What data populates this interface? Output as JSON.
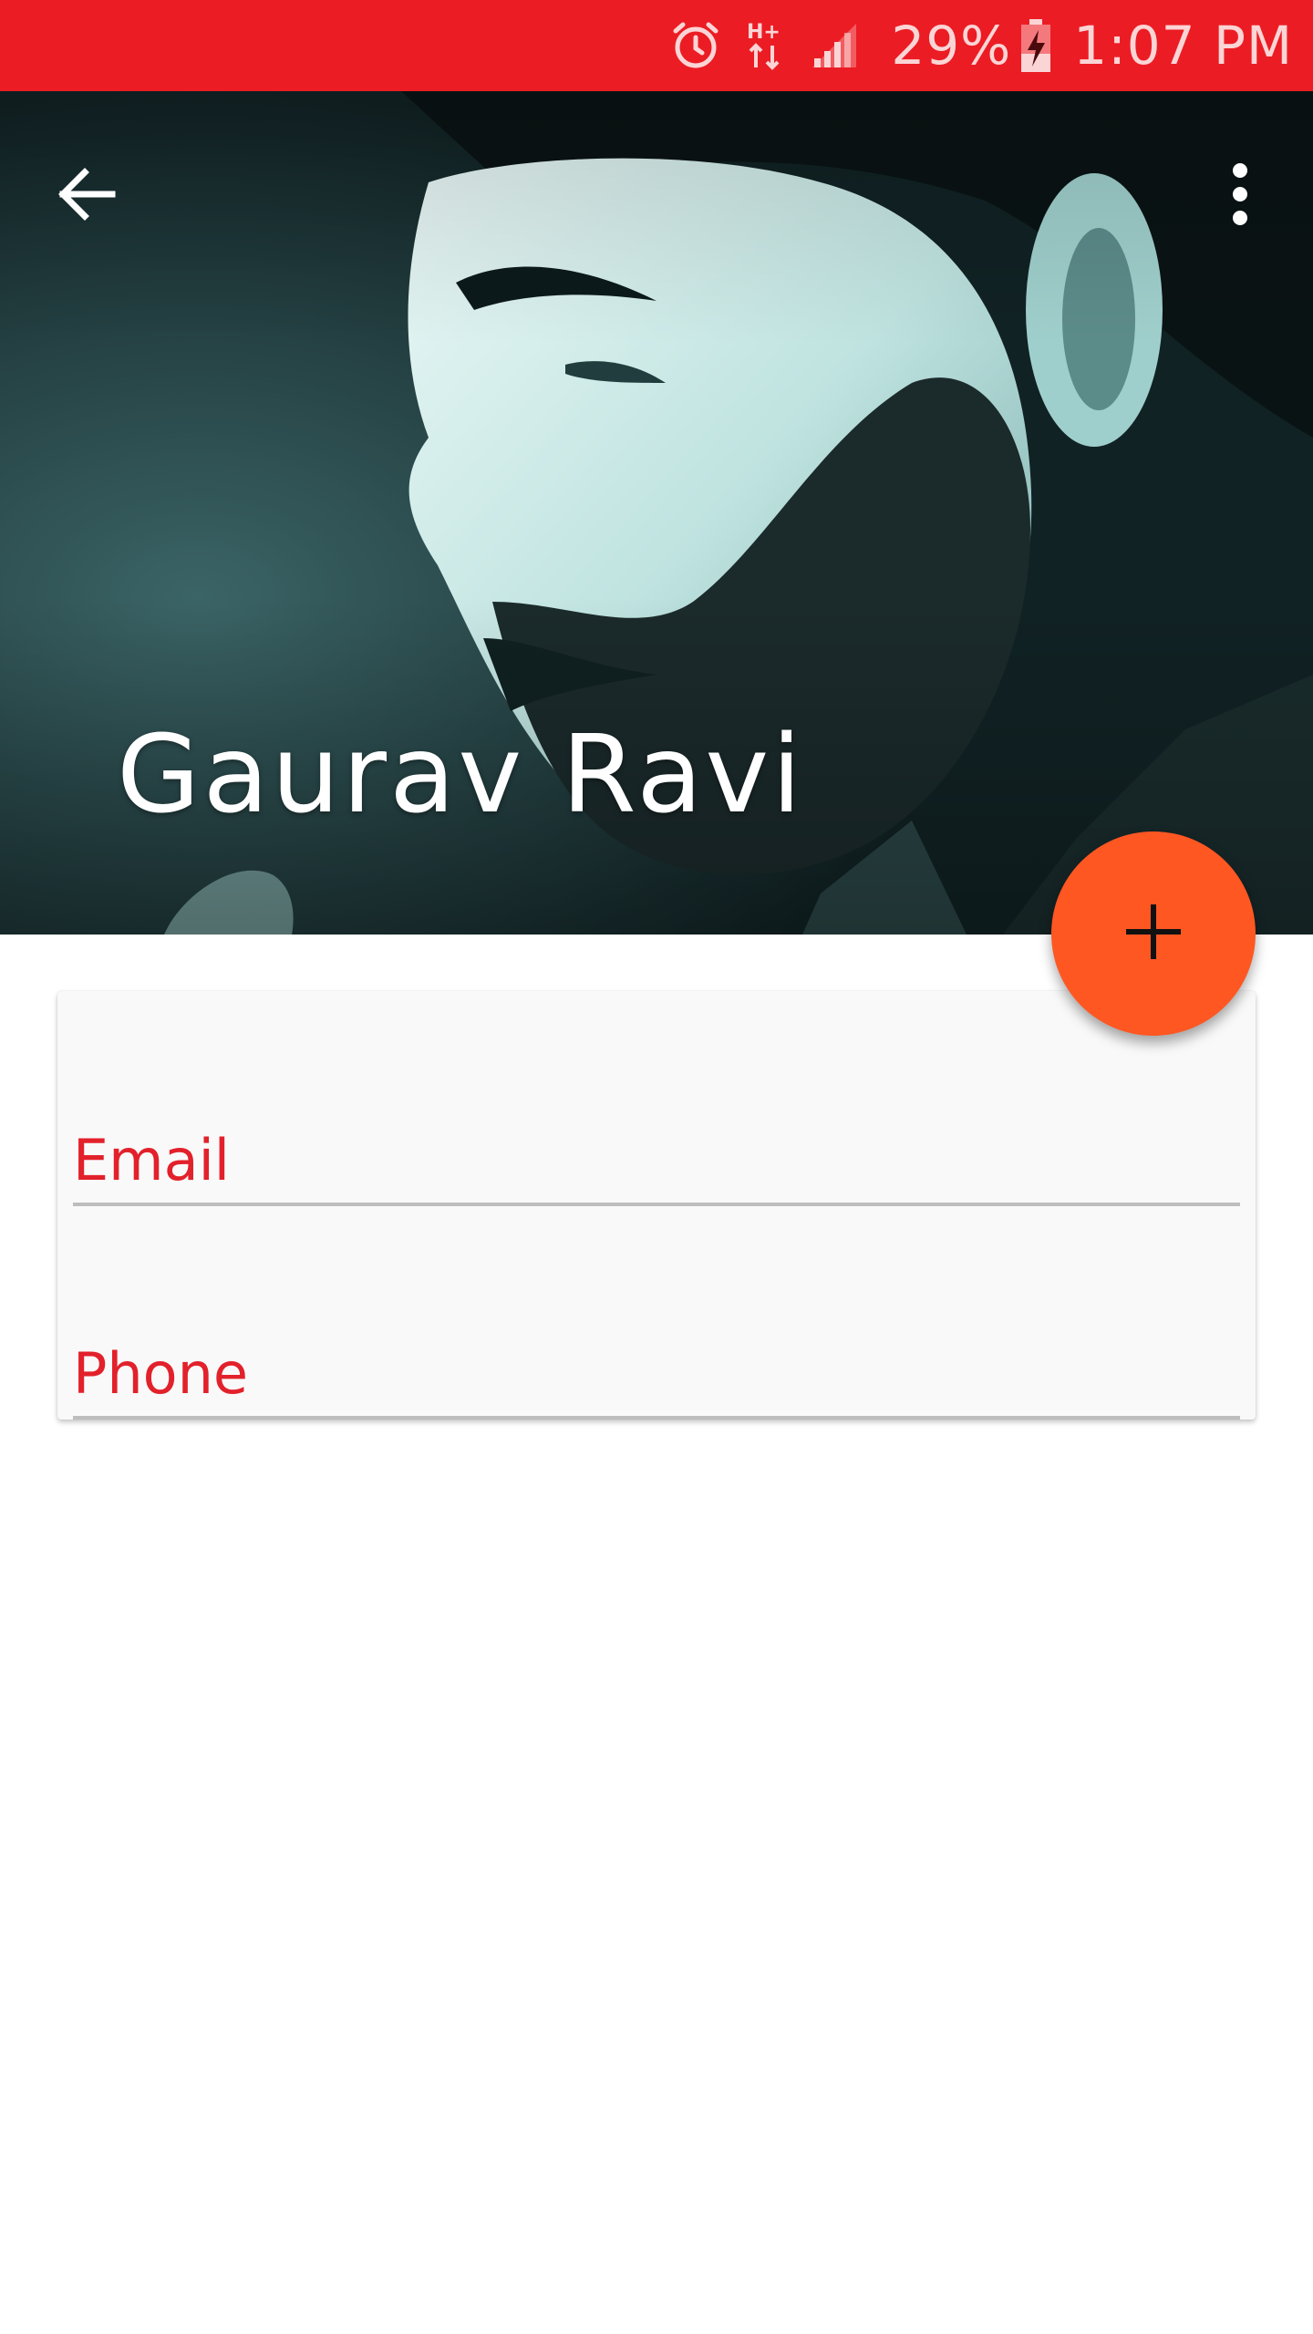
{
  "status_bar": {
    "icons": [
      "alarm-icon",
      "network-hplus-icon",
      "signal-icon",
      "battery-charging-icon"
    ],
    "battery": "29%",
    "time": "1:07 PM",
    "color": "#ec1c24"
  },
  "header": {
    "name": "Gaurav Ravi",
    "back_icon": "arrow-back-icon",
    "menu_icon": "more-vert-icon"
  },
  "fab": {
    "icon": "plus-icon",
    "color": "#ff5722"
  },
  "form": {
    "email_label": "Email",
    "phone_label": "Phone",
    "label_color": "#e2212b"
  }
}
